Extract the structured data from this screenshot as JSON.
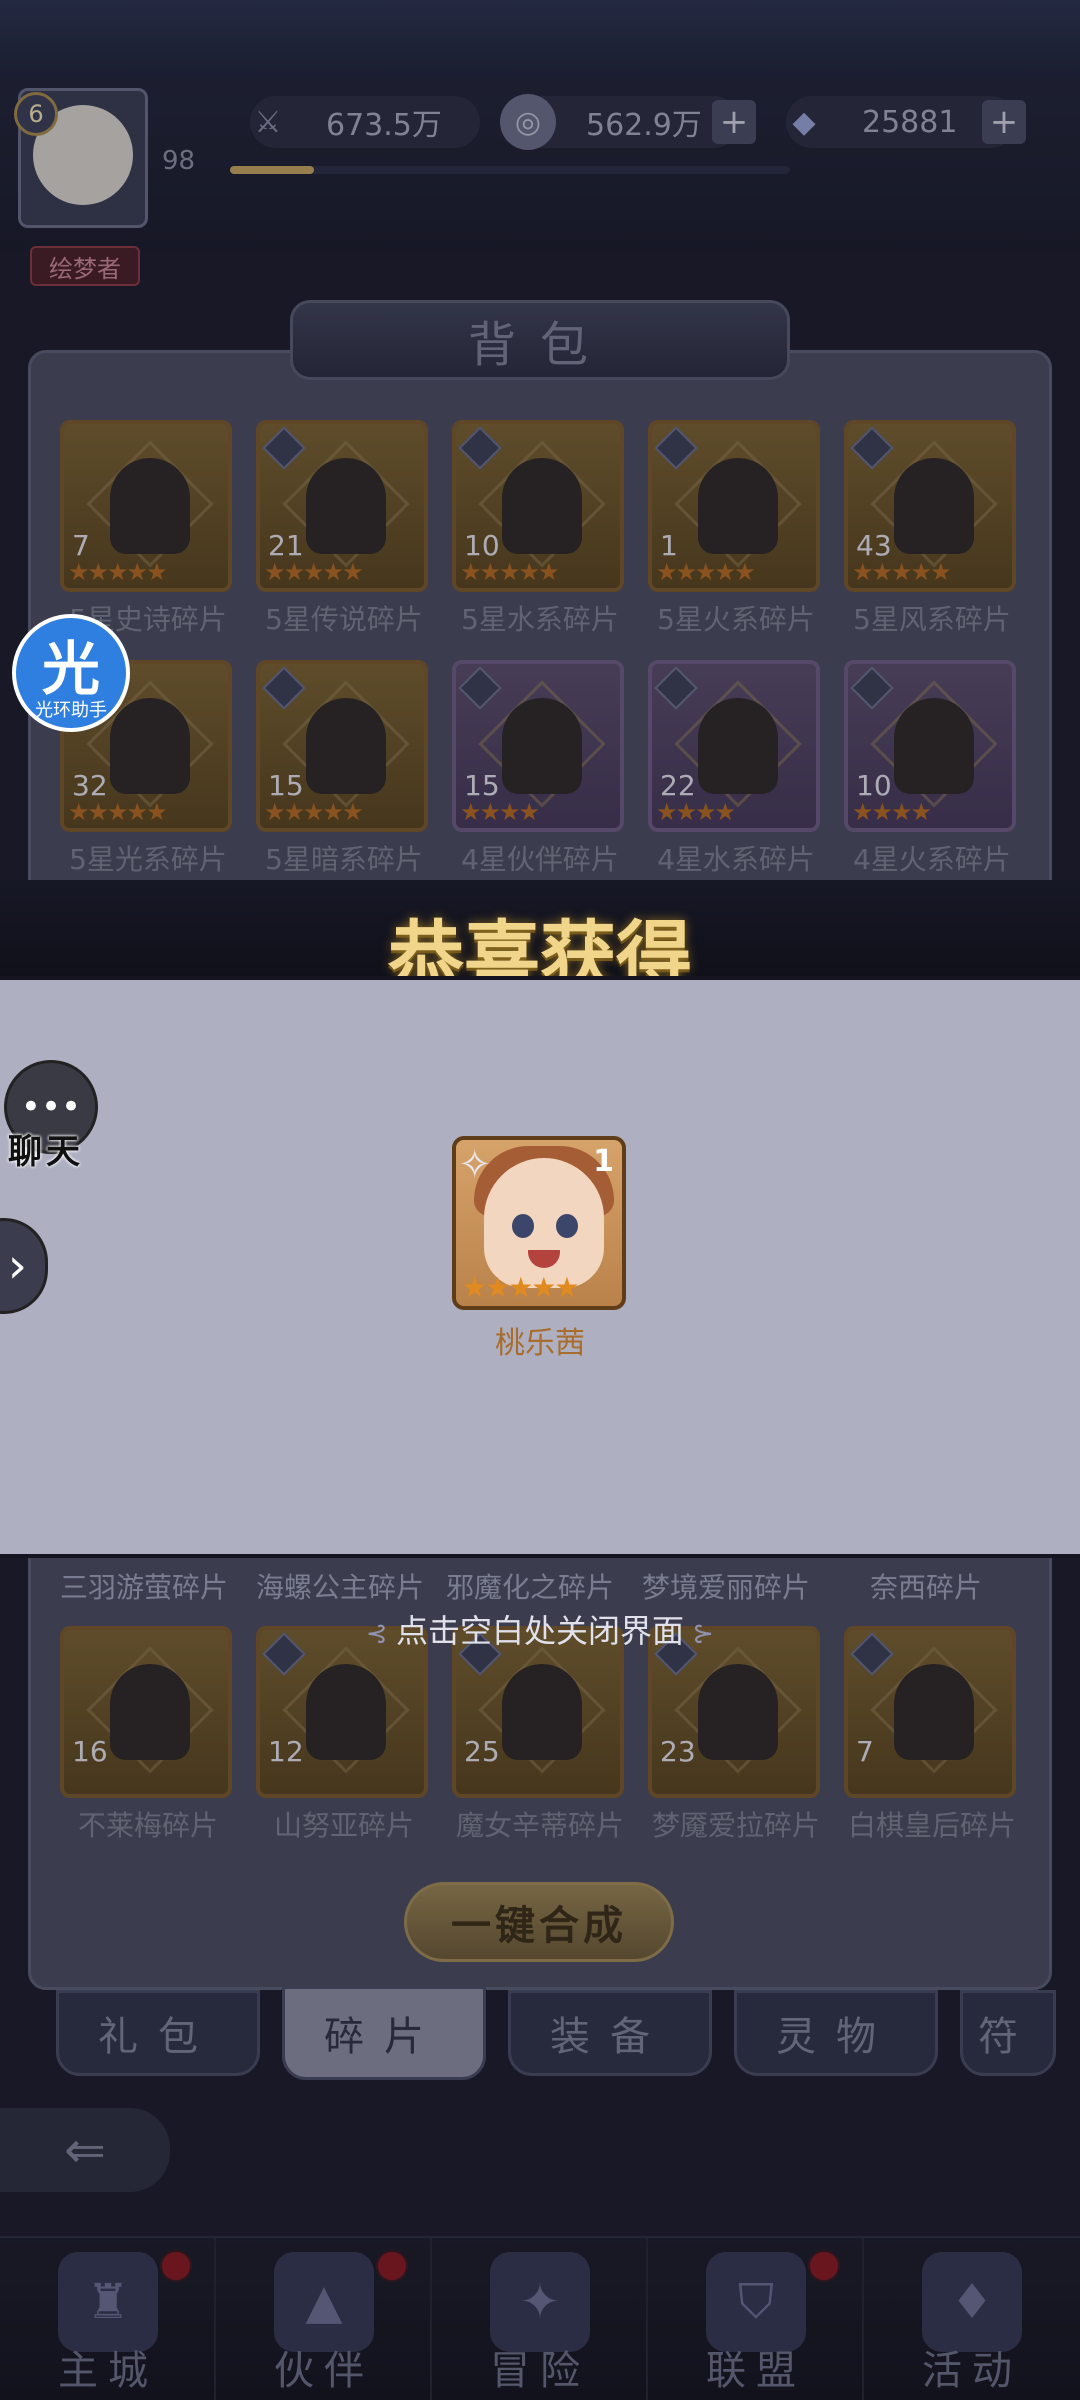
{
  "player": {
    "level": "6",
    "exp": "98",
    "exp_progress": 0.15,
    "title_badge": "绘梦者"
  },
  "resources": [
    {
      "icon": "sword-icon",
      "value": "673.5万"
    },
    {
      "icon": "gold-coin-icon",
      "value": "562.9万"
    },
    {
      "icon": "diamond-icon",
      "value": "25881"
    }
  ],
  "panel": {
    "title": "背包"
  },
  "items_row1": [
    {
      "count": "7",
      "label": "5星史诗碎片",
      "stars": "★★★★★",
      "style": "gold"
    },
    {
      "count": "21",
      "label": "5星传说碎片",
      "stars": "★★★★★",
      "style": "gold"
    },
    {
      "count": "10",
      "label": "5星水系碎片",
      "stars": "★★★★★",
      "style": "gold"
    },
    {
      "count": "1",
      "label": "5星火系碎片",
      "stars": "★★★★★",
      "style": "gold"
    },
    {
      "count": "43",
      "label": "5星风系碎片",
      "stars": "★★★★★",
      "style": "gold"
    }
  ],
  "items_row2": [
    {
      "count": "32",
      "label": "5星光系碎片",
      "stars": "★★★★★",
      "style": "gold"
    },
    {
      "count": "15",
      "label": "5星暗系碎片",
      "stars": "★★★★★",
      "style": "gold"
    },
    {
      "count": "15",
      "label": "4星伙伴碎片",
      "stars": "★★★★",
      "style": "purple"
    },
    {
      "count": "22",
      "label": "4星水系碎片",
      "stars": "★★★★",
      "style": "purple"
    },
    {
      "count": "10",
      "label": "4星火系碎片",
      "stars": "★★★★",
      "style": "purple"
    }
  ],
  "peek_labels": [
    "三羽游萤碎片",
    "海螺公主碎片",
    "邪魔化之碎片",
    "梦境爱丽碎片",
    "奈西碎片"
  ],
  "items_row5": [
    {
      "count": "16",
      "label": "不莱梅碎片",
      "stars": "",
      "style": "gold"
    },
    {
      "count": "12",
      "label": "山努亚碎片",
      "stars": "",
      "style": "gold"
    },
    {
      "count": "25",
      "label": "魔女辛蒂碎片",
      "stars": "",
      "style": "gold"
    },
    {
      "count": "23",
      "label": "梦魇爱拉碎片",
      "stars": "",
      "style": "gold"
    },
    {
      "count": "7",
      "label": "白棋皇后碎片",
      "stars": "",
      "style": "gold"
    }
  ],
  "reward": {
    "banner": "恭喜获得",
    "name": "桃乐茜",
    "count": "1",
    "stars": "★★★★★",
    "close_hint": "点击空白处关闭界面"
  },
  "combine_button": "一键合成",
  "tabs": [
    "礼包",
    "碎片",
    "装备",
    "灵物",
    "符"
  ],
  "active_tab": "碎片",
  "nav": [
    {
      "label": "主城",
      "icon": "castle-icon",
      "badge": true
    },
    {
      "label": "伙伴",
      "icon": "witch-hat-icon",
      "badge": true
    },
    {
      "label": "冒险",
      "icon": "compass-icon",
      "badge": false
    },
    {
      "label": "联盟",
      "icon": "shield-icon",
      "badge": true
    },
    {
      "label": "活动",
      "icon": "cards-icon",
      "badge": false
    }
  ],
  "floating": {
    "assist_big": "光",
    "assist_small": "光环助手",
    "chat_label": "聊天"
  }
}
